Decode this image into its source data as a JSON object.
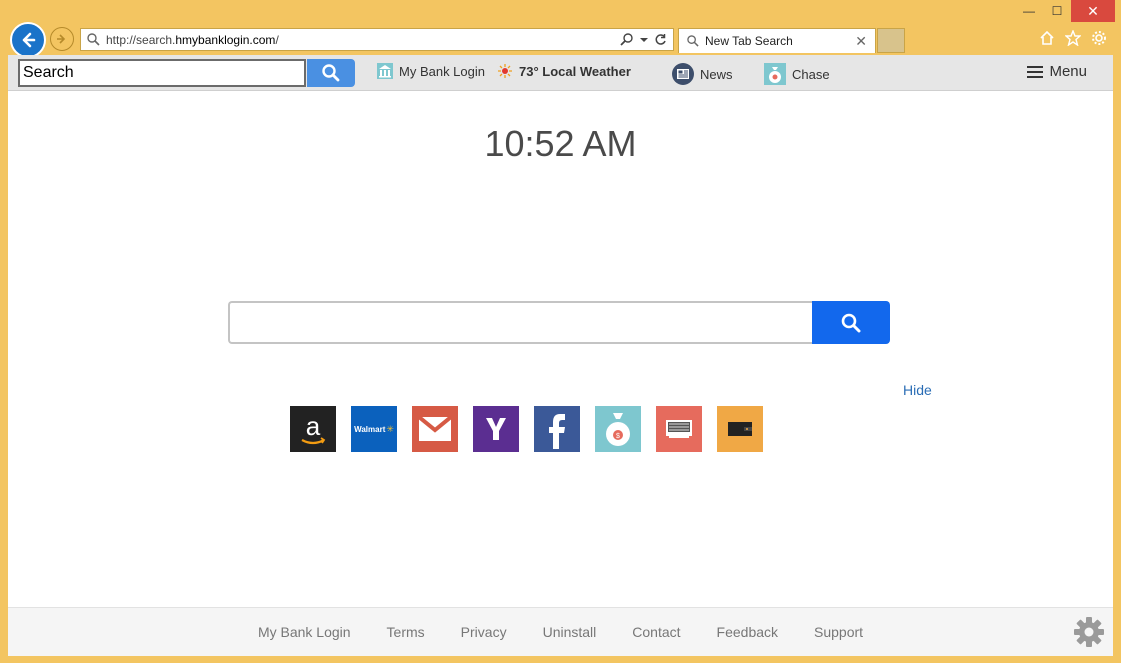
{
  "browser": {
    "url_prefix": "http://search.",
    "url_domain": "hmybanklogin.com",
    "url_suffix": "/",
    "tab_title": "New Tab Search"
  },
  "toolbar": {
    "search_value": "Search",
    "links": {
      "bank": "My Bank Login",
      "weather": "73° Local Weather",
      "news": "News",
      "chase": "Chase"
    },
    "menu_label": "Menu"
  },
  "main": {
    "time": "10:52 AM",
    "search_value": "",
    "hide_label": "Hide",
    "tiles": {
      "walmart_text": "Walmart"
    }
  },
  "footer": {
    "links": [
      "My Bank Login",
      "Terms",
      "Privacy",
      "Uninstall",
      "Contact",
      "Feedback",
      "Support"
    ]
  },
  "colors": {
    "frame": "#f3c561",
    "accent_blue": "#1268ed",
    "toolbar_blue": "#4a90e2",
    "amazon": "#222222",
    "walmart": "#0b61bd",
    "gmail": "#d65a45",
    "yahoo": "#5b2e91",
    "facebook": "#3b5998",
    "bank": "#7ec7cf",
    "news": "#e66b5d",
    "wallet": "#f0a845"
  },
  "icons": {
    "back": "arrow-left-icon",
    "forward": "arrow-right-icon",
    "home": "home-icon",
    "favorites": "star-icon",
    "settings": "gear-icon"
  }
}
